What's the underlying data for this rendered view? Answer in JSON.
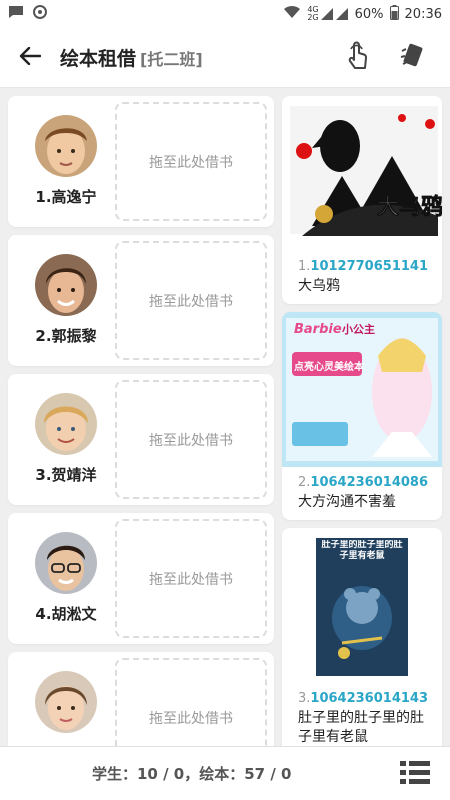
{
  "status_bar": {
    "left_icons": [
      "message-icon",
      "sync-icon"
    ],
    "signal_labels": [
      "4G",
      "2G"
    ],
    "battery_percent": "60%",
    "time": "20:36"
  },
  "header": {
    "title": "绘本租借",
    "subtitle": "[托二班]",
    "actions": [
      "touch-icon",
      "cards-icon"
    ]
  },
  "students": [
    {
      "name": "1.高逸宁",
      "drop_label": "拖至此处借书"
    },
    {
      "name": "2.郭振黎",
      "drop_label": "拖至此处借书"
    },
    {
      "name": "3.贺靖洋",
      "drop_label": "拖至此处借书"
    },
    {
      "name": "4.胡淞文",
      "drop_label": "拖至此处借书"
    },
    {
      "name": "",
      "drop_label": "拖至此处借书"
    }
  ],
  "books": [
    {
      "index": "1.",
      "code": "1012770651141",
      "title": "大乌鸦",
      "cover_text": "大乌鸦"
    },
    {
      "index": "2.",
      "code": "1064236014086",
      "title": "大方沟通不害羞",
      "cover_text": "点亮心灵美绘本",
      "cover_brand": "Barbie",
      "cover_series": "小公主"
    },
    {
      "index": "3.",
      "code": "1064236014143",
      "title": "肚子里的肚子里的肚子里有老鼠",
      "cover_text": "肚子里的肚子里的肚子里有老鼠"
    }
  ],
  "bottom": {
    "stats": "学生：10 / 0，绘本：57 / 0"
  },
  "colors": {
    "accent": "#2aa6c7",
    "background": "#efefef"
  }
}
